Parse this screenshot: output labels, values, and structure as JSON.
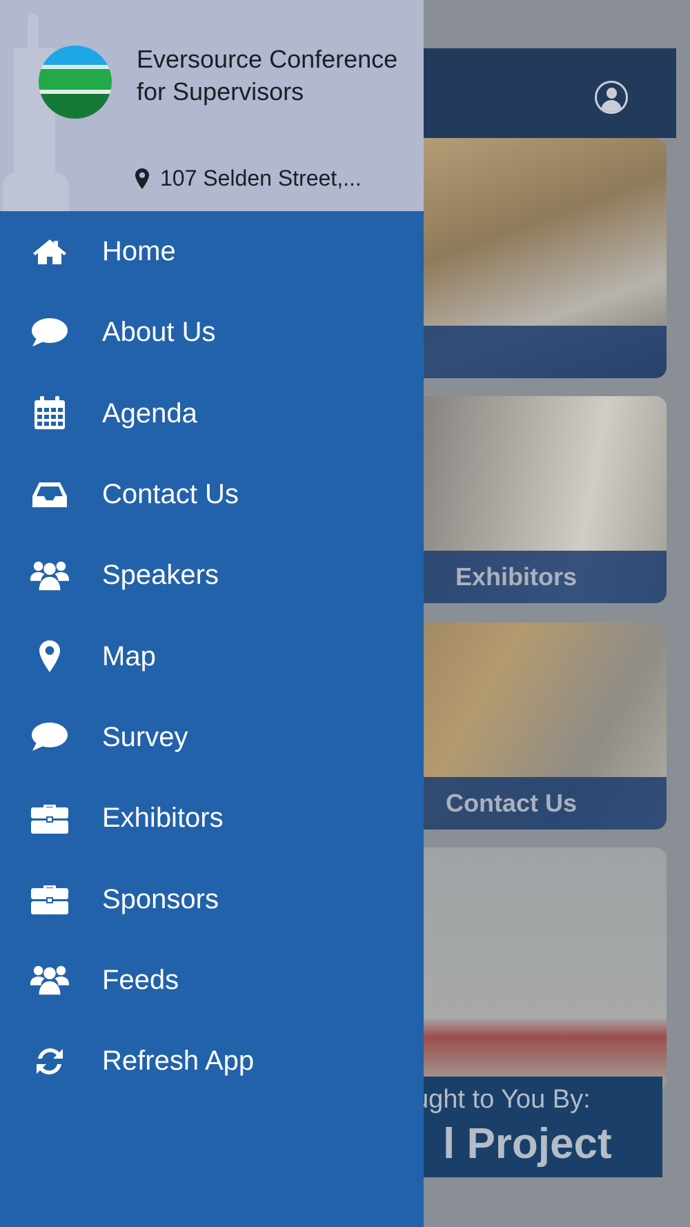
{
  "header": {
    "org_name": "Eversource Conference for Supervisors",
    "address": "107 Selden Street,...",
    "logo_colors": [
      "#1ea6e6",
      "#22a94a",
      "#157a38"
    ]
  },
  "menu": {
    "items": [
      {
        "label": "Home",
        "icon": "home-icon"
      },
      {
        "label": "About Us",
        "icon": "chat-bubble-icon"
      },
      {
        "label": "Agenda",
        "icon": "calendar-icon"
      },
      {
        "label": "Contact Us",
        "icon": "inbox-icon"
      },
      {
        "label": "Speakers",
        "icon": "users-icon"
      },
      {
        "label": "Map",
        "icon": "map-marker-icon"
      },
      {
        "label": "Survey",
        "icon": "chat-bubble-icon"
      },
      {
        "label": "Exhibitors",
        "icon": "briefcase-icon"
      },
      {
        "label": "Sponsors",
        "icon": "briefcase-icon"
      },
      {
        "label": "Feeds",
        "icon": "users-icon"
      },
      {
        "label": "Refresh App",
        "icon": "refresh-icon"
      }
    ]
  },
  "background": {
    "cards": [
      {
        "caption": ""
      },
      {
        "caption": "Exhibitors"
      },
      {
        "caption": "Contact Us"
      },
      {
        "caption": ""
      }
    ],
    "banner_line1": "ught to You By:",
    "banner_line2": "l Project"
  },
  "colors": {
    "drawer_bg": "#2262aa",
    "header_bg": "#b2b8ce",
    "topbar_bg": "#223b5c"
  }
}
